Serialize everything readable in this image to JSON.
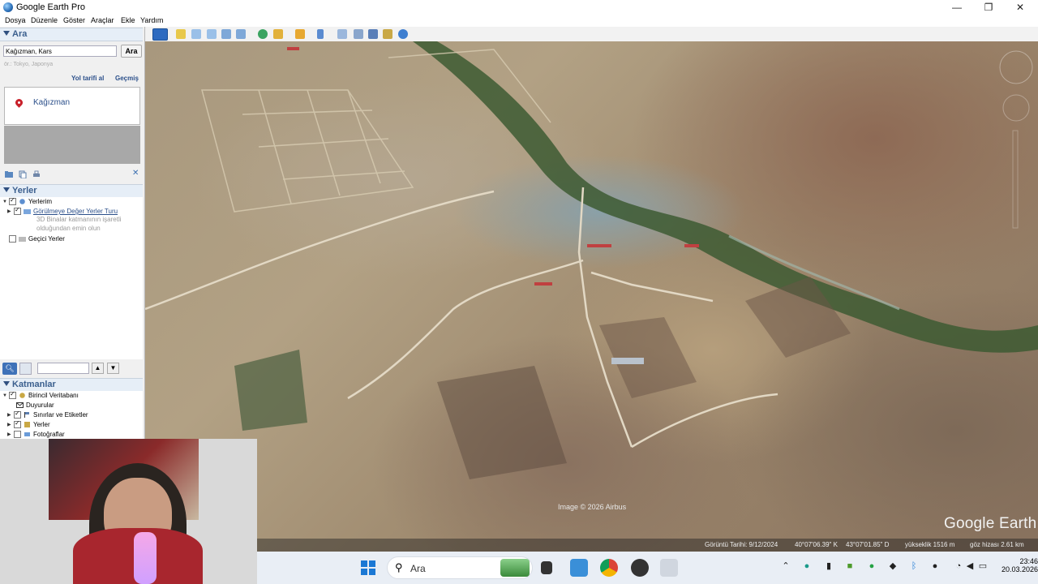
{
  "window": {
    "title": "Google Earth Pro",
    "minimize": "—",
    "maximize": "❐",
    "close": "✕"
  },
  "menu": [
    "Dosya",
    "Düzenle",
    "Göster",
    "Araçlar",
    "Ekle",
    "Yardım"
  ],
  "search": {
    "header": "Ara",
    "input_value": "Kağızman, Kars",
    "button_label": "Ara",
    "hint": "ör.: Tokyo, Japonya",
    "directions_link": "Yol tarifi al",
    "history_link": "Geçmiş",
    "result": "Kağızman"
  },
  "places": {
    "header": "Yerler",
    "my_places": "Yerlerim",
    "tour": "Görülmeye Değer Yerler Turu",
    "tour_note_1": "3D Binalar katmanının işaretli",
    "tour_note_2": "olduğundan emin olun",
    "temporary": "Geçici Yerler"
  },
  "layers": {
    "header": "Katmanlar",
    "items": [
      "Birincil Veritabanı",
      "Duyurular",
      "Sınırlar ve Etiketler",
      "Yerler",
      "Fotoğraflar"
    ]
  },
  "map": {
    "imagery_credit": "Image © 2026 Airbus",
    "logo": "Google Earth",
    "status": {
      "date": "Görüntü Tarihi: 9/12/2024",
      "lat": "40°07'06.39\" K",
      "lon": "43°07'01.85\" D",
      "elevation": "yükseklik  1516 m",
      "eye_alt": "göz hizası    2.61 km"
    }
  },
  "taskbar": {
    "search_label": "Ara",
    "time": "23:46",
    "date": "20.03.2026"
  }
}
